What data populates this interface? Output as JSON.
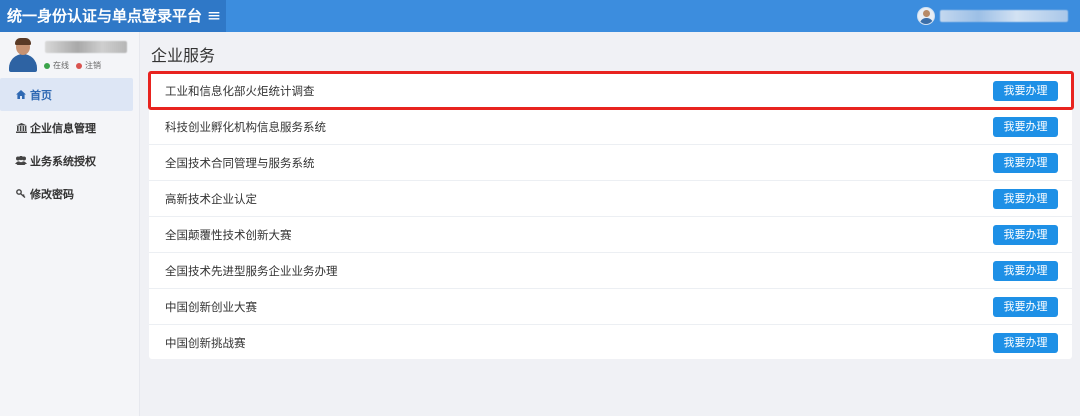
{
  "header": {
    "title": "统一身份认证与单点登录平台",
    "menu_icon": "hamburger-icon"
  },
  "user_top": {
    "avatar_icon": "user-avatar-icon"
  },
  "sidebar": {
    "status_online": "在线",
    "status_logout": "注销",
    "items": [
      {
        "label": "首页",
        "icon": "home-icon",
        "active": true
      },
      {
        "label": "企业信息管理",
        "icon": "bank-icon",
        "active": false
      },
      {
        "label": "业务系统授权",
        "icon": "users-icon",
        "active": false
      },
      {
        "label": "修改密码",
        "icon": "key-icon",
        "active": false
      }
    ]
  },
  "main": {
    "title": "企业服务",
    "action_label": "我要办理",
    "services": [
      {
        "label": "工业和信息化部火炬统计调查",
        "highlighted": true
      },
      {
        "label": "科技创业孵化机构信息服务系统"
      },
      {
        "label": "全国技术合同管理与服务系统"
      },
      {
        "label": "高新技术企业认定"
      },
      {
        "label": "全国颠覆性技术创新大赛"
      },
      {
        "label": "全国技术先进型服务企业业务办理"
      },
      {
        "label": "中国创新创业大赛"
      },
      {
        "label": "中国创新挑战赛"
      }
    ]
  },
  "colors": {
    "topbar": "#3c8dde",
    "brand": "#2f78c7",
    "button": "#1e90e6",
    "highlight": "#e8231f",
    "active_nav": "#dde6f5"
  }
}
